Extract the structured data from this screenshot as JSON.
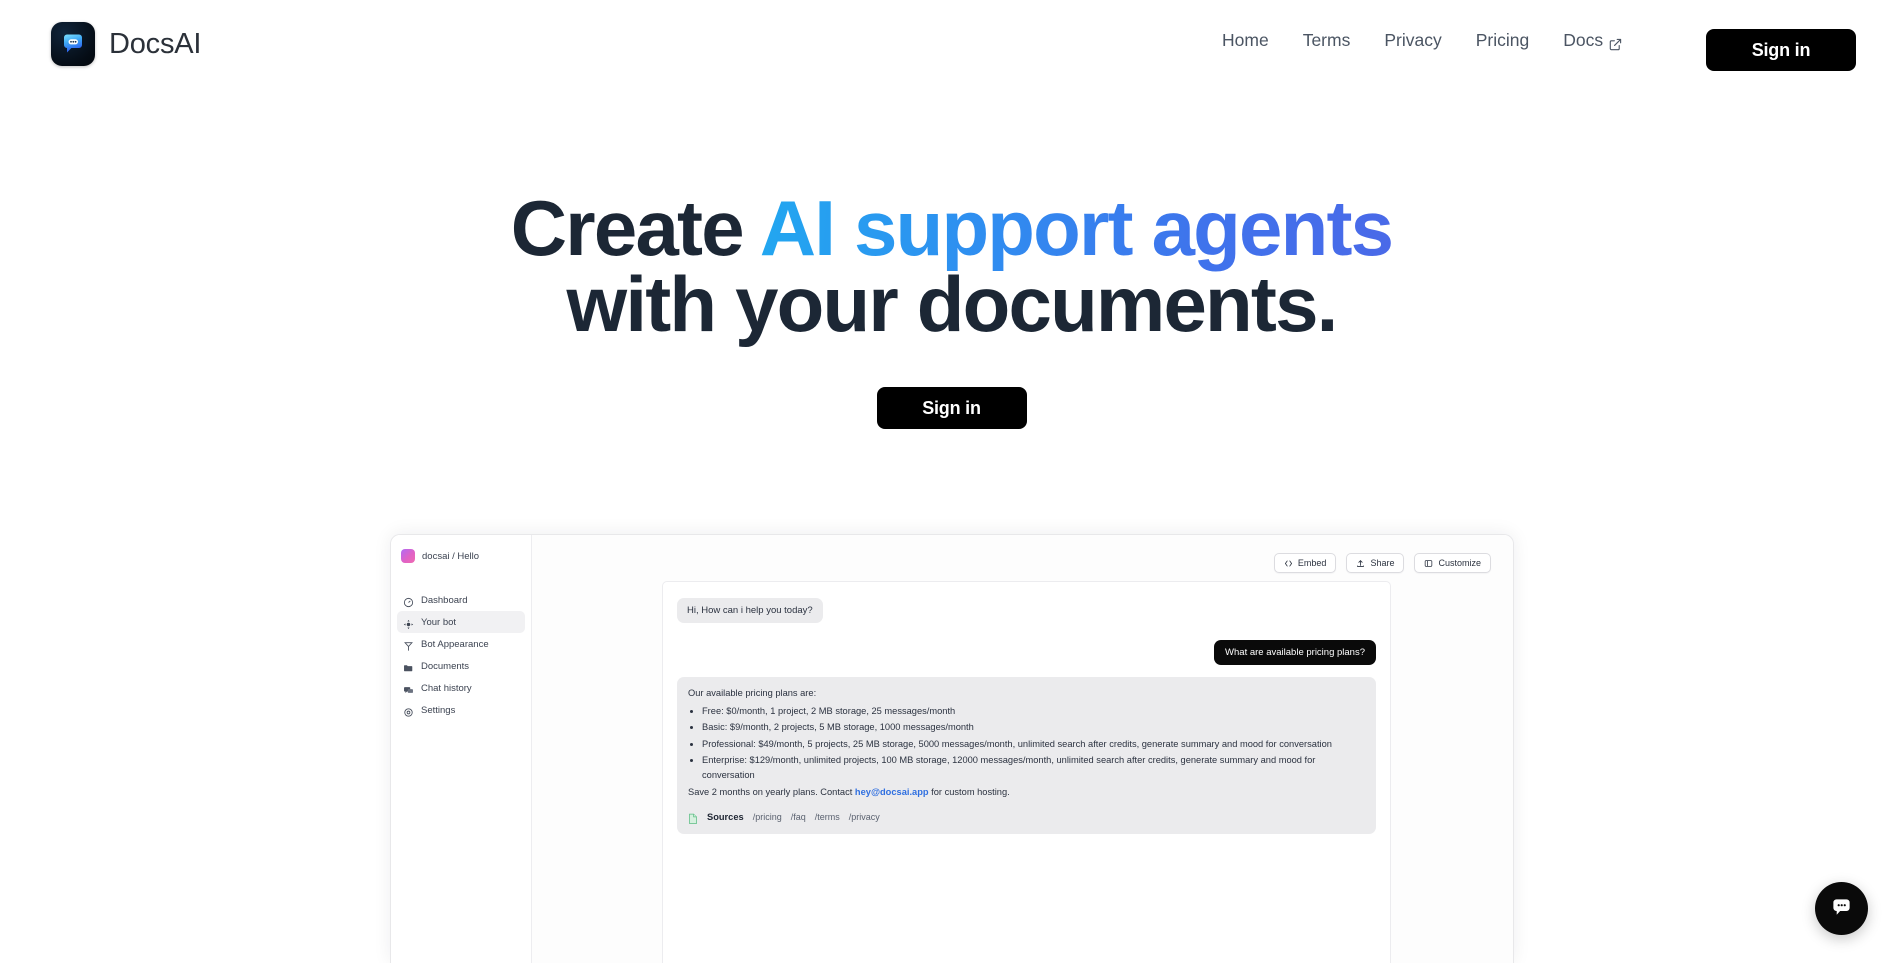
{
  "brand": {
    "name": "DocsAI",
    "logo_icon": "chat-bubble-icon"
  },
  "nav": {
    "links": [
      {
        "label": "Home",
        "icon": null
      },
      {
        "label": "Terms",
        "icon": null
      },
      {
        "label": "Privacy",
        "icon": null
      },
      {
        "label": "Pricing",
        "icon": null
      },
      {
        "label": "Docs",
        "icon": "external-link-icon"
      }
    ],
    "signin_label": "Sign in"
  },
  "hero": {
    "line1_plain": "Create ",
    "line1_accent": "AI support agents",
    "line2": "with your documents.",
    "cta_label": "Sign in",
    "accent_gradient_from": "#22a7f0",
    "accent_gradient_to": "#4a69e8",
    "heading_color": "#1c2735"
  },
  "app_preview": {
    "workspace": {
      "name": "docsai / Hello",
      "avatar_icon": "workspace-avatar"
    },
    "sidebar_items": [
      {
        "label": "Dashboard",
        "icon": "gauge-icon",
        "active": false
      },
      {
        "label": "Your bot",
        "icon": "bot-icon",
        "active": true
      },
      {
        "label": "Bot Appearance",
        "icon": "brush-icon",
        "active": false
      },
      {
        "label": "Documents",
        "icon": "folder-icon",
        "active": false
      },
      {
        "label": "Chat history",
        "icon": "chat-history-icon",
        "active": false
      },
      {
        "label": "Settings",
        "icon": "gear-icon",
        "active": false
      }
    ],
    "toolbar": [
      {
        "label": "Embed",
        "icon": "code-icon"
      },
      {
        "label": "Share",
        "icon": "share-upload-icon"
      },
      {
        "label": "Customize",
        "icon": "panel-icon"
      }
    ],
    "chat": {
      "bot_greeting": "Hi, How can i help you today?",
      "user_message": "What are available pricing plans?",
      "answer_intro": "Our available pricing plans are:",
      "answer_bullets": [
        "Free: $0/month, 1 project, 2 MB storage, 25 messages/month",
        "Basic: $9/month, 2 projects, 5 MB storage, 1000 messages/month",
        "Professional: $49/month, 5 projects, 25 MB storage, 5000 messages/month, unlimited search after credits, generate summary and mood for conversation",
        "Enterprise: $129/month, unlimited projects, 100 MB storage, 12000 messages/month, unlimited search after credits, generate summary and mood for conversation"
      ],
      "answer_footer_pre": "Save 2 months on yearly plans. Contact ",
      "answer_footer_link": "hey@docsai.app",
      "answer_footer_post": " for custom hosting.",
      "sources_label": "Sources",
      "sources": [
        "/pricing",
        "/faq",
        "/terms",
        "/privacy"
      ]
    }
  },
  "widget": {
    "icon": "chat-bubble-icon"
  }
}
